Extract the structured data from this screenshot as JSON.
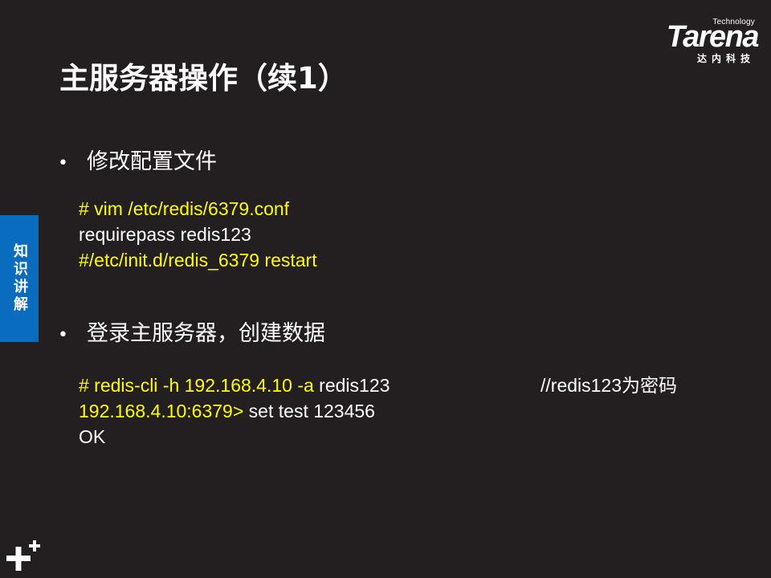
{
  "logo": {
    "small": "Technology",
    "main": "Tarena",
    "sub": "达内科技"
  },
  "title": "主服务器操作（续1）",
  "side_tab": "知识讲解",
  "bullets": [
    {
      "marker": "•",
      "text": "修改配置文件"
    },
    {
      "marker": "•",
      "text": "登录主服务器，创建数据"
    }
  ],
  "code_block_1": {
    "line1": "# vim /etc/redis/6379.conf",
    "line2": "requirepass redis123",
    "line3": "#/etc/init.d/redis_6379 restart"
  },
  "code_block_2": {
    "line1_cmd": "# redis-cli -h 192.168.4.10 -a",
    "line1_arg": " redis123",
    "line1_comment": "//redis123为密码",
    "line2_prompt": "192.168.4.10:6379>",
    "line2_cmd": " set test 123456",
    "line3": "OK"
  },
  "colors": {
    "background": "#231f20",
    "accent_yellow": "#ffff00",
    "side_tab_blue": "#0a6cbf",
    "text": "#ffffff"
  },
  "icons": {
    "bottom_left": "plus-plus-icon"
  }
}
